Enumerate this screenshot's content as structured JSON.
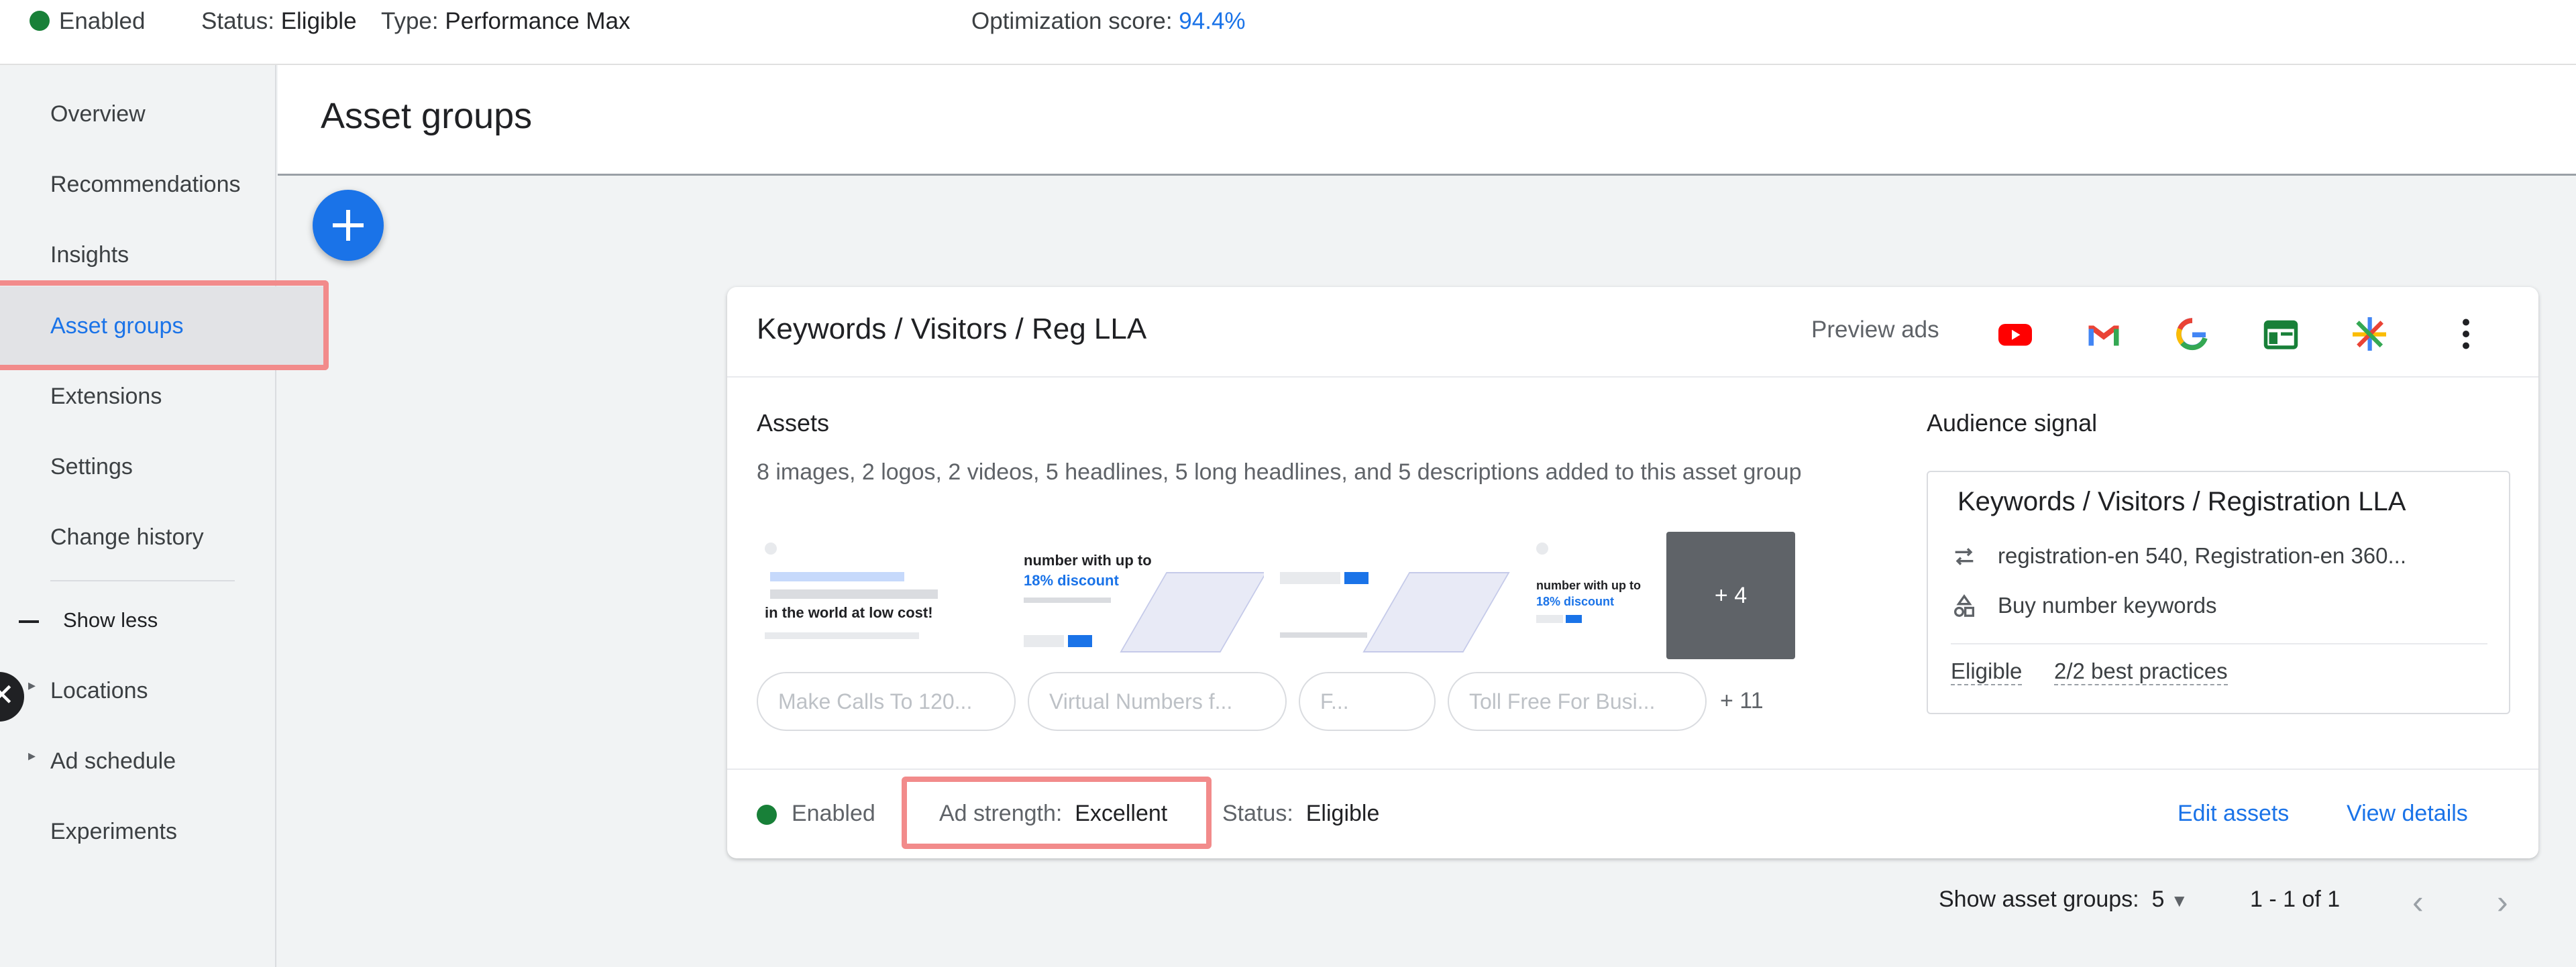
{
  "topbar": {
    "enabled": "Enabled",
    "status_label": "Status:",
    "status_value": "Eligible",
    "type_label": "Type:",
    "type_value": "Performance Max",
    "score_label": "Optimization score:",
    "score_value": "94.4%"
  },
  "sidebar": {
    "items": [
      {
        "label": "Overview"
      },
      {
        "label": "Recommendations"
      },
      {
        "label": "Insights"
      },
      {
        "label": "Asset groups"
      },
      {
        "label": "Extensions"
      },
      {
        "label": "Settings"
      },
      {
        "label": "Change history"
      }
    ],
    "show_less": "Show less",
    "sub_items": [
      {
        "label": "Locations"
      },
      {
        "label": "Ad schedule"
      },
      {
        "label": "Experiments"
      }
    ]
  },
  "page": {
    "title": "Asset groups"
  },
  "card": {
    "title": "Keywords / Visitors / Reg LLA",
    "preview_label": "Preview ads",
    "assets_heading": "Assets",
    "assets_desc": "8 images, 2 logos, 2 videos, 5 headlines, 5 long headlines, and 5 descriptions added to this asset group",
    "thumbs": {
      "t1": "in the world at low cost!",
      "t2a": "number with up to",
      "t2b": "18% discount",
      "t4a": "number with up to",
      "t4b": "18% discount",
      "more": "+ 4"
    },
    "chips": [
      "Make Calls To 120...",
      "Virtual Numbers f...",
      "F...",
      "Toll Free For Busi..."
    ],
    "more_chips": "+ 11",
    "audience": {
      "heading": "Audience signal",
      "title": "Keywords / Visitors / Registration LLA",
      "row1": "registration-en 540, Registration-en 360...",
      "row2": "Buy number keywords",
      "eligible": "Eligible",
      "best_practices": "2/2 best practices"
    },
    "footer": {
      "enabled": "Enabled",
      "ad_strength_label": "Ad strength:",
      "ad_strength_value": "Excellent",
      "status_label": "Status:",
      "status_value": "Eligible",
      "edit_assets": "Edit assets",
      "view_details": "View details"
    }
  },
  "pager": {
    "show_label": "Show asset groups:",
    "show_value": "5",
    "range": "1 - 1 of 1"
  },
  "icons": [
    "youtube-icon",
    "gmail-icon",
    "google-icon",
    "discover-icon",
    "display-network-icon",
    "more-vert-icon"
  ],
  "colors": {
    "accent": "#1a73e8",
    "status_green": "#188038",
    "highlight": "#f28b8b"
  }
}
